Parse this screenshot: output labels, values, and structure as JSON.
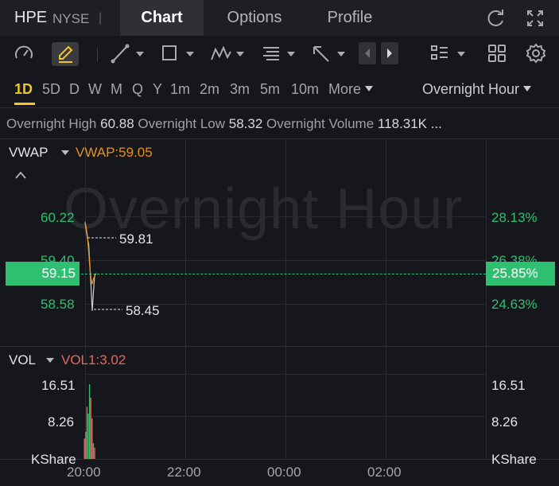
{
  "header": {
    "symbol": "HPE",
    "exchange": "NYSE",
    "separator": "|",
    "tabs": [
      {
        "label": "Chart",
        "active": true
      },
      {
        "label": "Options",
        "active": false
      },
      {
        "label": "Profile",
        "active": false
      }
    ],
    "icons": [
      "refresh-icon",
      "fullscreen-icon"
    ]
  },
  "toolbar": {
    "icons": [
      "gauge-icon",
      "pencil-icon",
      "trendline-icon",
      "rectangle-icon",
      "wave-pattern-icon",
      "text-align-icon",
      "arrow-cursor-icon",
      "prev-icon",
      "next-icon",
      "layout-list-icon",
      "grid-icon",
      "settings-icon"
    ]
  },
  "periods": {
    "items": [
      "1D",
      "5D",
      "D",
      "W",
      "M",
      "Q",
      "Y",
      "1m",
      "2m",
      "3m",
      "5m",
      "10m"
    ],
    "active": "1D",
    "more_label": "More",
    "session_label": "Overnight Hour"
  },
  "stats": {
    "high_label": "Overnight High",
    "high_value": "60.88",
    "low_label": "Overnight Low",
    "low_value": "58.32",
    "volume_label": "Overnight Volume",
    "volume_value": "118.31K",
    "ellipsis": "..."
  },
  "price_panel": {
    "indicator_name": "VWAP",
    "indicator_value": "VWAP:59.05",
    "watermark": "Overnight Hour",
    "y_labels_left": [
      "60.22",
      "59.40",
      "58.58"
    ],
    "y_labels_right": [
      "28.13%",
      "26.38%",
      "24.63%"
    ],
    "current_price": "59.15",
    "current_pct": "25.85%",
    "high_marker": "59.81",
    "low_marker": "58.45"
  },
  "volume_panel": {
    "indicator_name": "VOL",
    "indicator_value": "VOL1:3.02",
    "y_labels_left": [
      "16.51",
      "8.26",
      "KShare"
    ],
    "y_labels_right": [
      "16.51",
      "8.26",
      "KShare"
    ]
  },
  "time_axis": [
    "20:00",
    "22:00",
    "00:00",
    "02:00"
  ],
  "chart_data": {
    "type": "line",
    "x_ticks": [
      "20:00",
      "22:00",
      "00:00",
      "02:00"
    ],
    "price_ticks": [
      60.22,
      59.4,
      58.58
    ],
    "pct_ticks": [
      "28.13%",
      "26.38%",
      "24.63%"
    ],
    "series": [
      {
        "name": "Price",
        "color": "#d0d0d4",
        "points": [
          [
            0,
            60.1
          ],
          [
            1,
            59.95
          ],
          [
            2,
            59.81
          ],
          [
            3,
            59.7
          ],
          [
            4,
            59.3
          ],
          [
            5,
            58.9
          ],
          [
            6,
            58.45
          ],
          [
            7,
            58.8
          ],
          [
            8,
            59.1
          ],
          [
            9,
            59.15
          ]
        ]
      },
      {
        "name": "VWAP",
        "color": "#e2911f",
        "points": [
          [
            0,
            60.12
          ],
          [
            1,
            60.0
          ],
          [
            2,
            59.85
          ],
          [
            3,
            59.55
          ],
          [
            4,
            59.25
          ],
          [
            5,
            59.05
          ],
          [
            6,
            58.95
          ],
          [
            7,
            59.05
          ],
          [
            8,
            59.1
          ]
        ]
      }
    ],
    "current_price": 59.15,
    "high_marker": 59.81,
    "low_marker": 58.45,
    "volume": {
      "unit": "KShare",
      "ticks": [
        16.51,
        8.26
      ],
      "bars": [
        {
          "v": 4.5,
          "c": "red"
        },
        {
          "v": 6.0,
          "c": "green"
        },
        {
          "v": 11.5,
          "c": "red"
        },
        {
          "v": 10.0,
          "c": "green"
        },
        {
          "v": 16.5,
          "c": "green"
        },
        {
          "v": 13.5,
          "c": "red"
        },
        {
          "v": 9.0,
          "c": "red"
        },
        {
          "v": 3.5,
          "c": "green"
        },
        {
          "v": 2.5,
          "c": "red"
        }
      ]
    },
    "colors": {
      "up": "#2fbf71",
      "down": "#e8665c",
      "vwap": "#e2911f"
    }
  }
}
